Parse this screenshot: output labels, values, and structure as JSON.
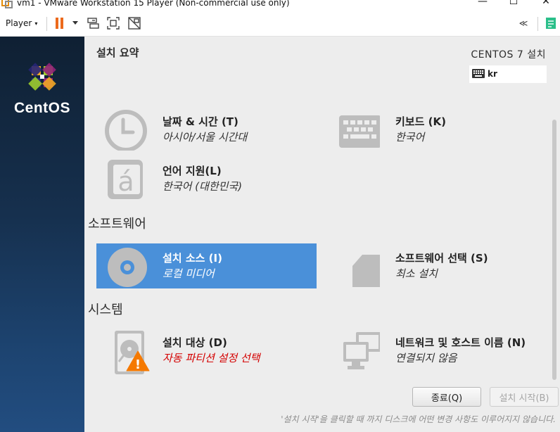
{
  "window": {
    "title": "vm1 - VMware Workstation 15 Player (Non-commercial use only)",
    "controls": {
      "minimize": "—",
      "maximize": "☐",
      "close": "✕"
    }
  },
  "toolbar": {
    "player_menu": "Player",
    "caret": "▾",
    "collapse": "≪",
    "icons": [
      "pause-icon",
      "dropdown-icon",
      "send-keys-icon",
      "fullscreen-icon",
      "unity-icon",
      "collapse-icon",
      "notes-icon"
    ]
  },
  "sidebar": {
    "brand": "CentOS"
  },
  "header": {
    "title": "설치 요약",
    "product": "CENTOS 7 설치",
    "keyboard_layout": "kr"
  },
  "sections": {
    "software": "소프트웨어",
    "system": "시스템"
  },
  "spokes": {
    "datetime": {
      "name": "날짜 & 시간 (T)",
      "status": "아시아/서울 시간대",
      "icon": "clock-icon"
    },
    "keyboard": {
      "name": "키보드 (K)",
      "status": "한국어",
      "icon": "keyboard-icon"
    },
    "language": {
      "name": "언어 지원(L)",
      "status": "한국어 (대한민국)",
      "icon": "language-icon",
      "glyph": "á"
    },
    "source": {
      "name": "설치 소스 (I)",
      "status": "로컬 미디어",
      "icon": "disc-icon",
      "selected": true
    },
    "software_selection": {
      "name": "소프트웨어 선택 (S)",
      "status": "최소 설치",
      "icon": "package-icon"
    },
    "destination": {
      "name": "설치 대상 (D)",
      "status": "자동 파티션 설정 선택",
      "icon": "harddisk-icon",
      "warning": true,
      "warning_glyph": "!"
    },
    "network": {
      "name": "네트워크 및 호스트 이름 (N)",
      "status": "연결되지 않음",
      "icon": "network-icon"
    }
  },
  "buttons": {
    "quit": "종료(Q)",
    "begin": "설치 시작(B)"
  },
  "footer_note": "'설치 시작'을 클릭할 때 까지 디스크에 어떤 변경 사항도 이루어지지 않습니다.",
  "colors": {
    "accent": "#4a90d9",
    "warning": "#d40000",
    "warning_triangle": "#f57900",
    "panel": "#ededed",
    "icon_gray": "#bdbdbd"
  }
}
